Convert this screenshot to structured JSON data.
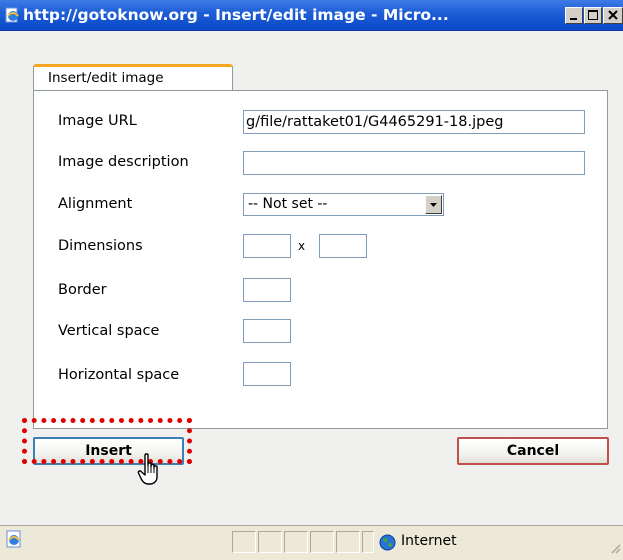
{
  "window": {
    "title": "http://gotoknow.org - Insert/edit image - Micro...",
    "icon": "ie-page-icon",
    "controls": [
      "minimize-icon",
      "maximize-icon",
      "close-icon"
    ]
  },
  "dialog": {
    "tab_label": "Insert/edit image",
    "fields": {
      "image_url": {
        "label": "Image URL",
        "value": "g/file/rattaket01/G4465291-18.jpeg"
      },
      "image_description": {
        "label": "Image description",
        "value": ""
      },
      "alignment": {
        "label": "Alignment",
        "selected": "-- Not set --"
      },
      "dimensions": {
        "label": "Dimensions",
        "width": "",
        "height": "",
        "separator": "x"
      },
      "border": {
        "label": "Border",
        "value": ""
      },
      "vertical_space": {
        "label": "Vertical space",
        "value": ""
      },
      "horizontal_space": {
        "label": "Horizontal space",
        "value": ""
      }
    },
    "buttons": {
      "insert": "Insert",
      "cancel": "Cancel"
    }
  },
  "statusbar": {
    "zone": "Internet"
  },
  "colors": {
    "titlebar": "#0a48c8",
    "tab_accent": "#f5a623",
    "highlight": "#e00000"
  }
}
